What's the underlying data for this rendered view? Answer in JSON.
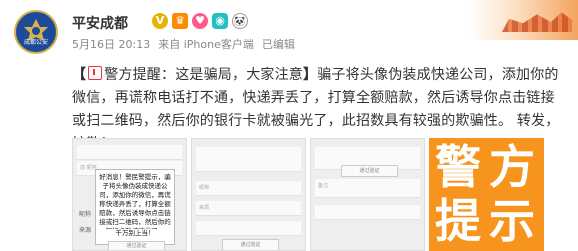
{
  "header": {
    "account_name": "平安成都",
    "avatar_text": "成都公安",
    "badges": [
      {
        "icon": "verified-v-icon",
        "glyph": "V"
      },
      {
        "icon": "member-badge-icon",
        "glyph": "♛"
      },
      {
        "icon": "heart-badge-icon",
        "glyph": "♥"
      },
      {
        "icon": "camera-badge-icon",
        "glyph": "◉"
      },
      {
        "icon": "panda-badge-icon",
        "glyph": "🐼"
      }
    ],
    "date": "5月16日 20:13",
    "source_prefix": "来自",
    "source": "iPhone客户端",
    "edited": "已编辑"
  },
  "post": {
    "open_bracket": "【",
    "title": "警方提醒：这是骗局，大家注意",
    "close_bracket": "】",
    "body": "骗子将头像伪装成快递公司，添加你的微信，再谎称电话打不通，快递弄丢了，打算全额赔款，然后诱导你点击链接或扫二维码，然后你的银行卡就被骗光了，此招数具有较强的欺骗性。 转发，扩散！"
  },
  "images": {
    "thumb1": {
      "field_label_1": "前 昵称",
      "field_label_2": "来源",
      "bubble_text": "好消息！警民警提示，骗子将头像伪装成快递公司，添加你的微信，再谎称快递弄丢了，打算全额赔款，然后诱导你点击链接或扫二维码，然后你的银行卡就被骗光了。",
      "footer_text": "千万别上当！",
      "button_text": "通过验证"
    },
    "thumb2": {
      "field_label_1": "昵称",
      "field_label_2": "来源",
      "button_text": "通过验证"
    },
    "thumb3": {
      "field_label_1": "备注",
      "button_text": "通过验证"
    },
    "warning_card": {
      "chars": [
        "警",
        "方",
        "提",
        "示"
      ],
      "bg_color": "#f7941d"
    }
  }
}
